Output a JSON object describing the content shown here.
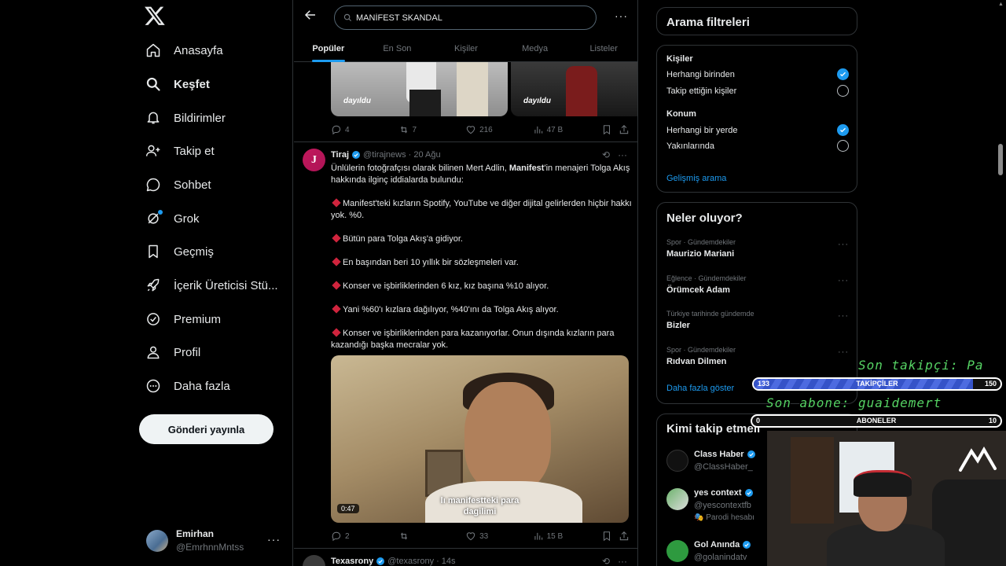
{
  "nav": {
    "items": [
      {
        "label": "Anasayfa",
        "icon": "home-icon"
      },
      {
        "label": "Keşfet",
        "icon": "search-icon"
      },
      {
        "label": "Bildirimler",
        "icon": "bell-icon"
      },
      {
        "label": "Takip et",
        "icon": "add-person-icon"
      },
      {
        "label": "Sohbet",
        "icon": "chat-icon"
      },
      {
        "label": "Grok",
        "icon": "grok-icon"
      },
      {
        "label": "Geçmiş",
        "icon": "bookmark-icon"
      },
      {
        "label": "İçerik Üreticisi Stü...",
        "icon": "rocket-icon"
      },
      {
        "label": "Premium",
        "icon": "verified-icon"
      },
      {
        "label": "Profil",
        "icon": "person-icon"
      },
      {
        "label": "Daha fazla",
        "icon": "more-circle-icon"
      }
    ],
    "post_button": "Gönderi yayınla",
    "account": {
      "name": "Emirhan",
      "handle": "@EmrhnnMntss"
    }
  },
  "search": {
    "query": "MANİFEST SKANDAL"
  },
  "tabs": [
    "Popüler",
    "En Son",
    "Kişiler",
    "Medya",
    "Listeler"
  ],
  "first_tweet": {
    "watermark": "dayıldu",
    "watermark2": "dayıldu",
    "replies": "4",
    "reposts": "7",
    "likes": "216",
    "views": "47 B"
  },
  "tweet": {
    "author": "Tiraj",
    "handle": "@tirajnews",
    "date": "· 20 Ağu",
    "intro_pre": "Ünlülerin fotoğrafçısı olarak bilinen Mert Adlin, ",
    "intro_bold": "Manifest",
    "intro_post": "'in menajeri Tolga Akış hakkında ilginç iddialarda bulundu:",
    "bullets": [
      "Manifest'teki kızların Spotify, YouTube ve diğer dijital gelirlerden hiçbir hakkı yok. %0.",
      "Bütün para Tolga Akış'a gidiyor.",
      "En başından beri 10 yıllık bir sözleşmeleri var.",
      "Konser ve işbirliklerinden 6 kız, kız başına %10 alıyor.",
      "Yani %60'ı kızlara dağılıyor, %40'ını da Tolga Akış alıyor.",
      "Konser ve işbirliklerinden para kazanıyorlar. Onun dışında kızların para kazandığı başka mecralar yok."
    ],
    "video_caption_1": "lı manifestteki para",
    "video_caption_2": "dagilimi",
    "duration": "0:47",
    "replies": "2",
    "reposts": "",
    "likes": "33",
    "views": "15 B"
  },
  "tweet2": {
    "author": "Texasrony",
    "handle": "@texasrony",
    "date": "· 14s"
  },
  "filters": {
    "title": "Arama filtreleri",
    "people_label": "Kişiler",
    "people_options": [
      {
        "label": "Herhangi birinden",
        "selected": true
      },
      {
        "label": "Takip ettiğin kişiler",
        "selected": false
      }
    ],
    "location_label": "Konum",
    "location_options": [
      {
        "label": "Herhangi bir yerde",
        "selected": true
      },
      {
        "label": "Yakınlarında",
        "selected": false
      }
    ],
    "advanced": "Gelişmiş arama"
  },
  "trends": {
    "title": "Neler oluyor?",
    "items": [
      {
        "category": "Spor · Gündemdekiler",
        "name": "Maurizio Mariani"
      },
      {
        "category": "Eğlence · Gündemdekiler",
        "name": "Örümcek Adam"
      },
      {
        "category": "Türkiye tarihinde gündemde",
        "name": "Bizler"
      },
      {
        "category": "Spor · Gündemdekiler",
        "name": "Rıdvan Dilmen"
      }
    ],
    "show_more": "Daha fazla göster"
  },
  "who_to_follow": {
    "title": "Kimi takip etmeli",
    "items": [
      {
        "name": "Class Haber",
        "handle": "@ClassHaber_",
        "extra": ""
      },
      {
        "name": "yes context",
        "handle": "@yescontextfb",
        "extra": "Parodi hesabı"
      },
      {
        "name": "Gol Anında",
        "handle": "@golanindatv",
        "extra": ""
      }
    ]
  },
  "overlay": {
    "last_follower": "Son takipçi: Pa",
    "followers_bar": {
      "left": "133",
      "label": "TAKİPÇİLER",
      "right": "150",
      "progress": 0.89
    },
    "last_sub": "Son abone: guaidemert",
    "subs_bar": {
      "left": "0",
      "label": "ABONELER",
      "right": "10",
      "progress": 0
    }
  },
  "colors": {
    "accent": "#1d9bf0",
    "background": "#000000",
    "border": "#2f3336",
    "muted": "#71767b",
    "overlay_green": "#56d364"
  }
}
